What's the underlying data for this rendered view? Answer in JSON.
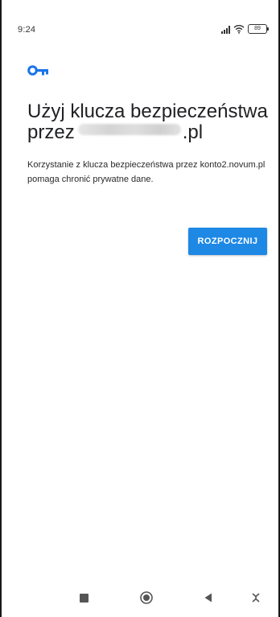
{
  "status_bar": {
    "time": "9:24",
    "battery": "89",
    "icons": [
      "signal-icon",
      "wifi-icon",
      "battery-icon"
    ]
  },
  "content": {
    "icon": "key-icon",
    "icon_color": "#1a73e8",
    "heading_line1": "Użyj klucza bezpieczeństwa",
    "heading_line2_prefix": "przez",
    "heading_line2_suffix": ".pl",
    "description": "Korzystanie z klucza bezpieczeństwa przez konto2.novum.pl pomaga chronić prywatne dane.",
    "start_button_label": "ROZPOCZNIJ",
    "accent_color": "#1e88e5"
  },
  "nav_bar": {
    "buttons": [
      "recents-icon",
      "home-icon",
      "back-icon",
      "accessibility-icon"
    ]
  }
}
